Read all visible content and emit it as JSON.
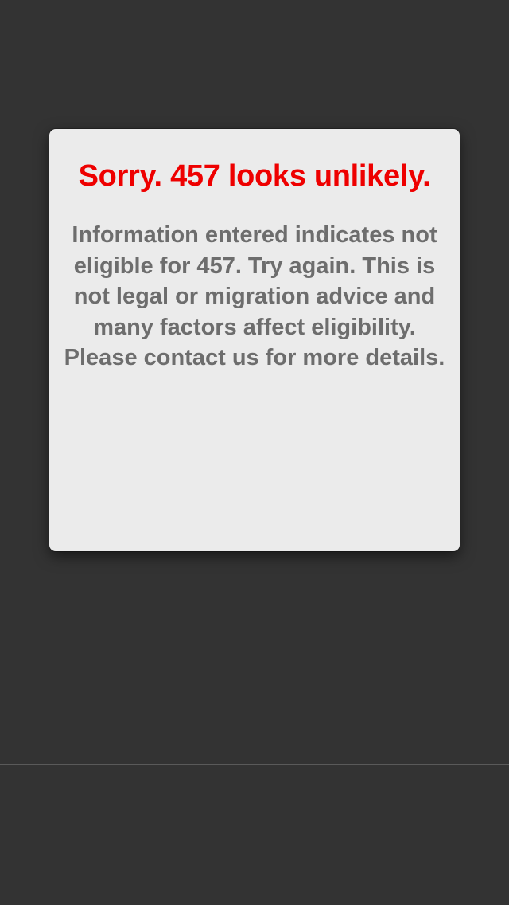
{
  "dialog": {
    "title": "Sorry. 457 looks unlikely.",
    "message": "Information entered indicates not eligible for 457. Try again. This is not legal or migration advice and many factors affect eligibility. Please contact us for more details."
  },
  "colors": {
    "background": "#333333",
    "dialog_background": "#ebebeb",
    "title_color": "#ee0000",
    "message_color": "#6d6d6d"
  }
}
